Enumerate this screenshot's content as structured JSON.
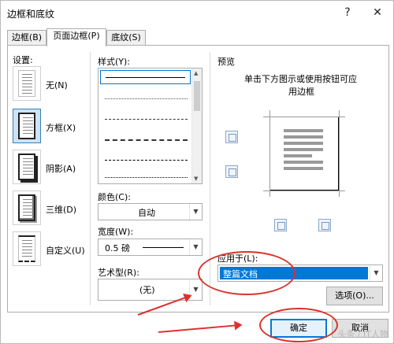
{
  "window": {
    "title": "边框和底纹",
    "help_label": "?",
    "close_label": "✕"
  },
  "tabs": [
    {
      "label": "边框(B)",
      "active": false
    },
    {
      "label": "页面边框(P)",
      "active": true
    },
    {
      "label": "底纹(S)",
      "active": false
    }
  ],
  "settings": {
    "heading": "设置:",
    "items": [
      {
        "label": "无(N)"
      },
      {
        "label": "方框(X)",
        "selected": true
      },
      {
        "label": "阴影(A)"
      },
      {
        "label": "三维(D)"
      },
      {
        "label": "自定义(U)"
      }
    ]
  },
  "style": {
    "heading": "样式(Y):",
    "options": [
      "solid",
      "dotted",
      "dashed",
      "dashed",
      "dash-dot",
      "dash-dot-dot"
    ]
  },
  "color": {
    "label": "颜色(C):",
    "value": "自动"
  },
  "width": {
    "label": "宽度(W):",
    "value": "0.5 磅"
  },
  "art": {
    "label": "艺术型(R):",
    "value": "(无)"
  },
  "preview": {
    "heading": "预览",
    "instruction_line1": "单击下方图示或使用按钮可应",
    "instruction_line2": "用边框"
  },
  "apply_to": {
    "label": "应用于(L):",
    "value": "整篇文档"
  },
  "buttons": {
    "options": "选项(O)...",
    "ok": "确定",
    "cancel": "取消"
  },
  "watermark": "头条 / IT人物",
  "accent_colors": {
    "selection": "#0078d7",
    "annotation_red": "#d9342b"
  }
}
